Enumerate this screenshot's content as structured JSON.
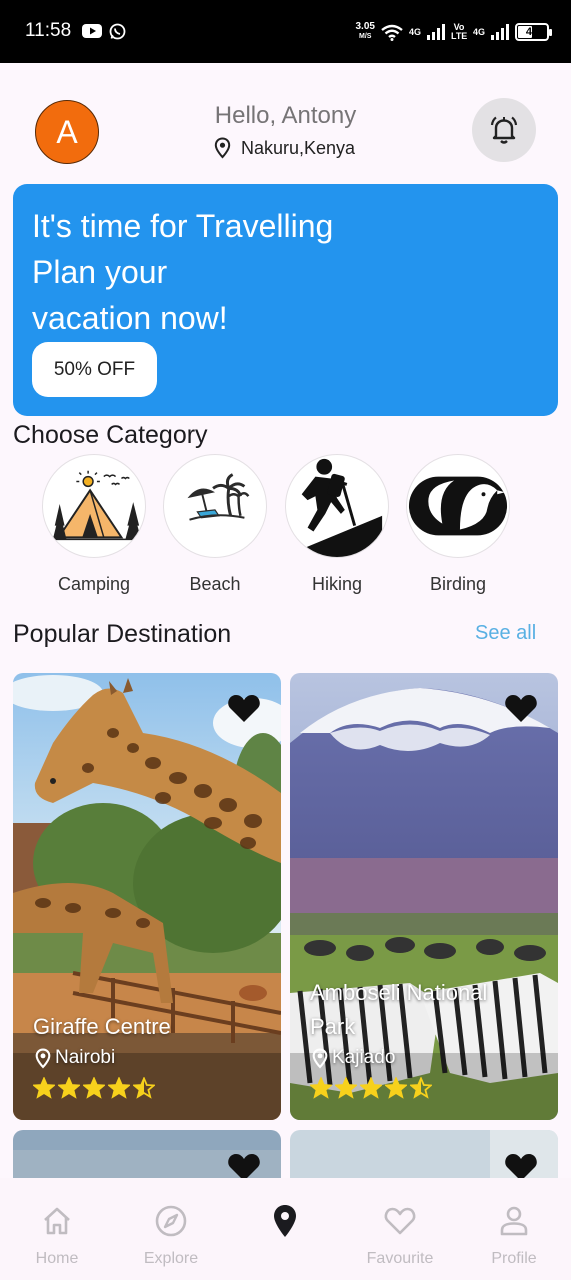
{
  "status_bar": {
    "time": "11:58",
    "net_speed_value": "3.05",
    "net_speed_unit": "M/S",
    "sim1_label": "4G",
    "volte_label": "Vo LTE",
    "sim2_label": "4G",
    "battery": "45"
  },
  "header": {
    "avatar_initial": "A",
    "greeting": "Hello, Antony",
    "location": "Nakuru,Kenya"
  },
  "banner": {
    "line1": "It's time for Travelling",
    "line2": "Plan your",
    "line3": "vacation now!",
    "offer_label": "50% OFF",
    "color": "#2394ee"
  },
  "categories": {
    "title": "Choose Category",
    "items": [
      {
        "label": "Camping",
        "icon": "tent-icon"
      },
      {
        "label": "Beach",
        "icon": "beach-icon",
        "icon_text": "BEACH"
      },
      {
        "label": "Hiking",
        "icon": "hiker-icon"
      },
      {
        "label": "Birding",
        "icon": "bird-icon"
      }
    ]
  },
  "popular": {
    "title": "Popular Destination",
    "see_all": "See all",
    "destinations": [
      {
        "name": "Giraffe Centre",
        "location": "Nairobi",
        "rating": 4.5
      },
      {
        "name": "Amboseli National Park",
        "name_line1": "Amboseli National",
        "name_line2": "Park",
        "location": "Kajiado",
        "rating": 4.5
      }
    ]
  },
  "bottom_nav": {
    "items": [
      {
        "label": "Home",
        "icon": "home-icon"
      },
      {
        "label": "Explore",
        "icon": "compass-icon"
      },
      {
        "label": "",
        "icon": "location-pin-icon",
        "active": true
      },
      {
        "label": "Favourite",
        "icon": "heart-outline-icon"
      },
      {
        "label": "Profile",
        "icon": "profile-icon"
      }
    ]
  },
  "colors": {
    "accent": "#2394ee",
    "avatar": "#f26c0d",
    "see_all": "#59b0e3",
    "star": "#f7d11c"
  }
}
